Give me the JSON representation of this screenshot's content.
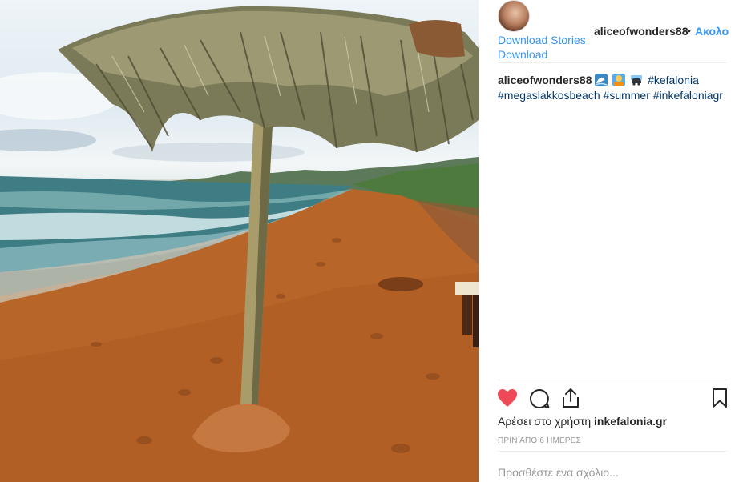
{
  "post": {
    "username": "aliceofwonders88",
    "separator": "•",
    "follow_label": "Ακολο",
    "extension_links": [
      "Download Stories",
      "Download"
    ]
  },
  "caption": {
    "username": "aliceofwonders88",
    "emojis": [
      "wave-icon",
      "person-sunbathing-icon",
      "beach-car-icon"
    ],
    "hashtags": [
      "#kefalonia",
      "#megaslakkosbeach",
      "#summer",
      "#inkefaloniagr"
    ]
  },
  "actions": {
    "like_icon": "heart-icon",
    "comment_icon": "comment-icon",
    "share_icon": "share-icon",
    "save_icon": "bookmark-icon",
    "liked_color": "#ed4956"
  },
  "likes": {
    "prefix": "Αρέσει στο χρήστη",
    "user": "inkefalonia.gr"
  },
  "timestamp": "ΠΡΙΝ ΑΠΟ 6 ΗΜΕΡΕΣ",
  "comment_input": {
    "placeholder": "Προσθέστε ένα σχόλιο..."
  },
  "colors": {
    "link_blue": "#3897f0",
    "hashtag_blue": "#003569",
    "muted": "#999999"
  }
}
